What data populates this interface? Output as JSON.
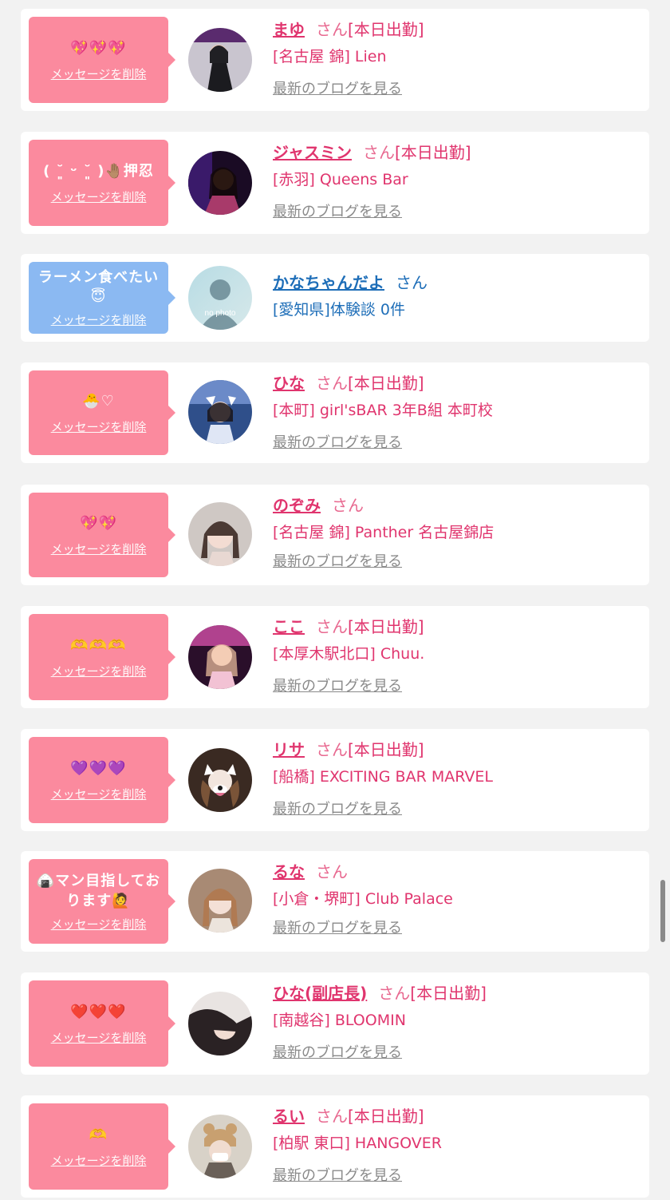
{
  "delete_label": "メッセージを削除",
  "blog_label": "最新のブログを見る",
  "san_label": "さん",
  "cards": [
    {
      "message": "💖💖💖",
      "name": "まゆ",
      "work": "[本日出勤]",
      "shop": "[名古屋 錦] Lien"
    },
    {
      "message": "( ˘͈ ᵕ ˘͈ )🤚🏽押忍",
      "name": "ジャスミン",
      "work": "[本日出勤]",
      "shop": "[赤羽] Queens Bar"
    },
    {
      "message": "ラーメン食べたい😇",
      "name": "かなちゃんだよ",
      "work": "",
      "shop": "[愛知県]体験談 0件",
      "avatar_text": "no photo"
    },
    {
      "message": "🐣♡",
      "name": "ひな",
      "work": "[本日出勤]",
      "shop": "[本町] girl'sBAR 3年B組 本町校"
    },
    {
      "message": "💖💖",
      "name": "のぞみ",
      "work": "",
      "shop": "[名古屋 錦] Panther 名古屋錦店"
    },
    {
      "message": "🫶🫶🫶",
      "name": "ここ",
      "work": "[本日出勤]",
      "shop": "[本厚木駅北口] Chuu."
    },
    {
      "message": "💜💜💜",
      "name": "リサ",
      "work": "[本日出勤]",
      "shop": "[船橋] EXCITING BAR MARVEL"
    },
    {
      "message": "🍙マン目指しております🙋",
      "name": "るな",
      "work": "",
      "shop": "[小倉・堺町] Club Palace"
    },
    {
      "message": "❤️❤️❤️",
      "name": "ひな(副店長)",
      "work": "[本日出勤]",
      "shop": "[南越谷] BLOOMIN"
    },
    {
      "message": "🫶",
      "name": "るい",
      "work": "[本日出勤]",
      "shop": "[柏駅 東口] HANGOVER"
    }
  ]
}
